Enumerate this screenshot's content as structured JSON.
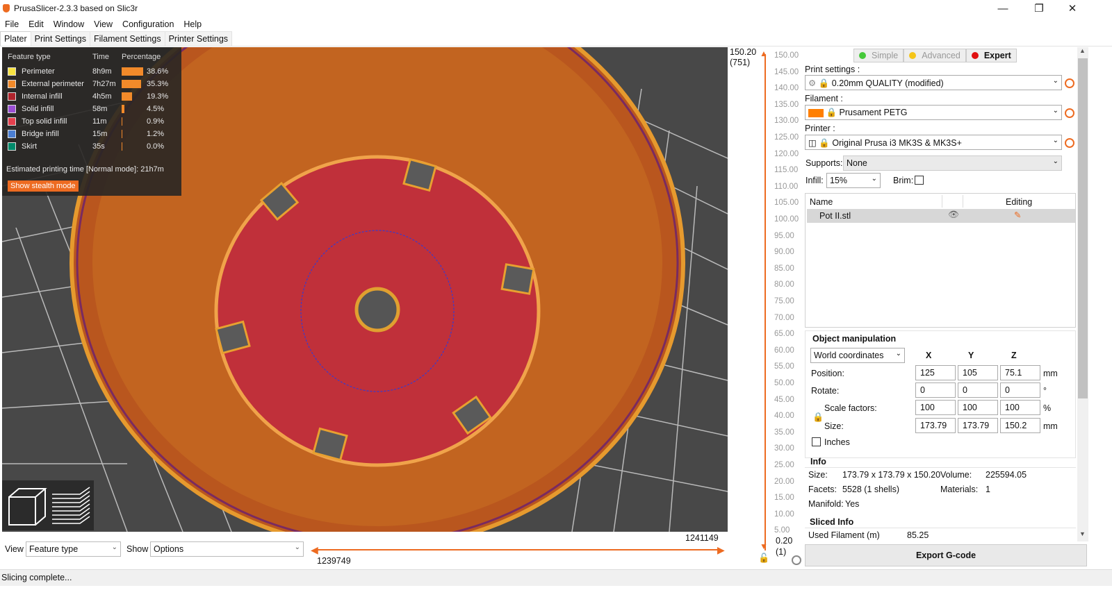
{
  "window": {
    "title": "PrusaSlicer-2.3.3 based on Slic3r"
  },
  "menu": [
    "File",
    "Edit",
    "Window",
    "View",
    "Configuration",
    "Help"
  ],
  "tabs": [
    "Plater",
    "Print Settings",
    "Filament Settings",
    "Printer Settings"
  ],
  "legend": {
    "headers": {
      "type": "Feature type",
      "time": "Time",
      "percentage": "Percentage"
    },
    "rows": [
      {
        "name": "Perimeter",
        "time": "8h9m",
        "percent": "38.6%",
        "fraction": 0.386,
        "color": "#f7e342"
      },
      {
        "name": "External perimeter",
        "time": "7h27m",
        "percent": "35.3%",
        "fraction": 0.353,
        "color": "#f28a2a"
      },
      {
        "name": "Internal infill",
        "time": "4h5m",
        "percent": "19.3%",
        "fraction": 0.193,
        "color": "#b0242c"
      },
      {
        "name": "Solid infill",
        "time": "58m",
        "percent": "4.5%",
        "fraction": 0.045,
        "color": "#9a4ed4"
      },
      {
        "name": "Top solid infill",
        "time": "11m",
        "percent": "0.9%",
        "fraction": 0.009,
        "color": "#e5404e"
      },
      {
        "name": "Bridge infill",
        "time": "15m",
        "percent": "1.2%",
        "fraction": 0.012,
        "color": "#4b7fd3"
      },
      {
        "name": "Skirt",
        "time": "35s",
        "percent": "0.0%",
        "fraction": 0.0,
        "color": "#008a6a"
      }
    ],
    "estimated": "Estimated printing time [Normal mode]:",
    "estimated_value": "21h7m",
    "stealth_button": "Show stealth mode"
  },
  "bottom": {
    "view_label": "View",
    "view_value": "Feature type",
    "show_label": "Show",
    "show_value": "Options",
    "h_top": "1241149",
    "h_bottom": "1239749"
  },
  "vslider": {
    "top_value": "150.20",
    "top_layer": "(751)",
    "bottom_value": "0.20",
    "bottom_layer": "(1)",
    "ticks": [
      "150.00",
      "145.00",
      "140.00",
      "135.00",
      "130.00",
      "125.00",
      "120.00",
      "115.00",
      "110.00",
      "105.00",
      "100.00",
      "95.00",
      "90.00",
      "85.00",
      "80.00",
      "75.00",
      "70.00",
      "65.00",
      "60.00",
      "55.00",
      "50.00",
      "45.00",
      "40.00",
      "35.00",
      "30.00",
      "25.00",
      "20.00",
      "15.00",
      "10.00",
      "5.00"
    ]
  },
  "sidebar": {
    "modes": [
      {
        "label": "Simple",
        "color": "#46c93a"
      },
      {
        "label": "Advanced",
        "color": "#f5c518"
      },
      {
        "label": "Expert",
        "color": "#e01010"
      }
    ],
    "print_settings_label": "Print settings :",
    "print_settings_value": "0.20mm QUALITY (modified)",
    "filament_label": "Filament :",
    "filament_value": "Prusament PETG",
    "filament_color": "#ff7f00",
    "printer_label": "Printer :",
    "printer_value": "Original Prusa i3 MK3S & MK3S+",
    "supports_label": "Supports:",
    "supports_value": "None",
    "infill_label": "Infill:",
    "infill_value": "15%",
    "brim_label": "Brim:"
  },
  "objlist": {
    "col_name": "Name",
    "col_editing": "Editing",
    "item": "Pot II.stl"
  },
  "objman": {
    "title": "Object manipulation",
    "coords": "World coordinates",
    "axes": [
      "X",
      "Y",
      "Z"
    ],
    "position_label": "Position:",
    "position": [
      "125",
      "105",
      "75.1"
    ],
    "position_unit": "mm",
    "rotate_label": "Rotate:",
    "rotate": [
      "0",
      "0",
      "0"
    ],
    "rotate_unit": "°",
    "scale_label": "Scale factors:",
    "scale": [
      "100",
      "100",
      "100"
    ],
    "scale_unit": "%",
    "size_label": "Size:",
    "size": [
      "173.79",
      "173.79",
      "150.2"
    ],
    "size_unit": "mm",
    "inches_label": "Inches"
  },
  "info": {
    "title": "Info",
    "size_label": "Size:",
    "size_value": "173.79 x 173.79 x 150.20",
    "volume_label": "Volume:",
    "volume_value": "225594.05",
    "facets_label": "Facets:",
    "facets_value": "5528 (1 shells)",
    "materials_label": "Materials:",
    "materials_value": "1",
    "manifold_label": "Manifold:",
    "manifold_value": "Yes"
  },
  "sliced": {
    "title": "Sliced Info",
    "filament_label": "Used Filament (m)",
    "filament_value": "85.25"
  },
  "export_button": "Export G-code",
  "status": "Slicing complete..."
}
